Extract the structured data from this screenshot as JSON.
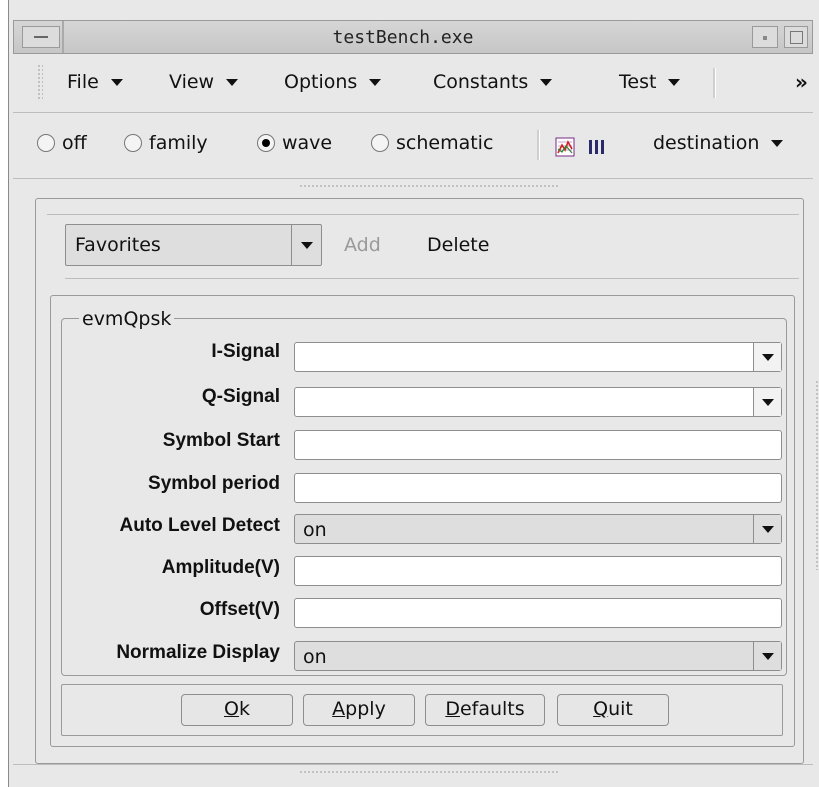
{
  "window": {
    "title": "testBench.exe"
  },
  "menubar": {
    "items": [
      {
        "label": "File"
      },
      {
        "label": "View"
      },
      {
        "label": "Options"
      },
      {
        "label": "Constants"
      },
      {
        "label": "Test"
      }
    ],
    "overflow": "»"
  },
  "radios": {
    "options": [
      {
        "label": "off",
        "selected": false
      },
      {
        "label": "family",
        "selected": false
      },
      {
        "label": "wave",
        "selected": true
      },
      {
        "label": "schematic",
        "selected": false
      }
    ],
    "destination_label": "destination"
  },
  "favorites": {
    "value": "Favorites",
    "add_label": "Add",
    "delete_label": "Delete"
  },
  "form": {
    "group_title": "evmQpsk",
    "fields": [
      {
        "label": "I-Signal",
        "value": ""
      },
      {
        "label": "Q-Signal",
        "value": ""
      },
      {
        "label": "Symbol Start",
        "value": ""
      },
      {
        "label": "Symbol period",
        "value": ""
      },
      {
        "label": "Auto Level Detect",
        "value": "on"
      },
      {
        "label": "Amplitude(V)",
        "value": ""
      },
      {
        "label": "Offset(V)",
        "value": ""
      },
      {
        "label": "Normalize Display",
        "value": "on"
      }
    ]
  },
  "buttons": {
    "ok": {
      "mnemonic": "O",
      "rest": "k"
    },
    "apply": {
      "mnemonic": "A",
      "rest": "pply"
    },
    "defaults": {
      "mnemonic": "D",
      "rest": "efaults"
    },
    "quit": {
      "mnemonic": "Q",
      "rest": "uit"
    }
  }
}
